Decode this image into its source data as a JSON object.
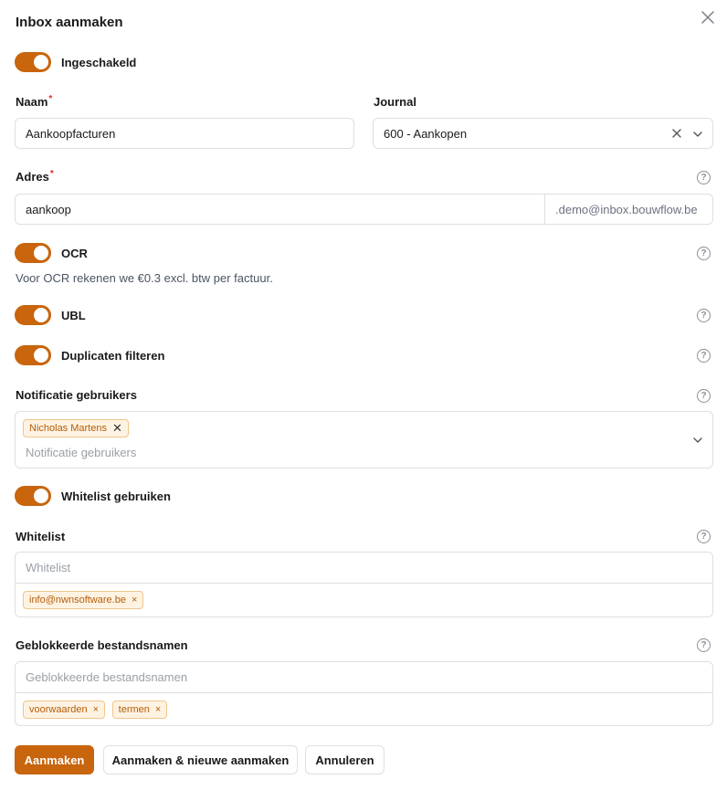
{
  "dialog": {
    "title": "Inbox aanmaken"
  },
  "enabled": {
    "label": "Ingeschakeld",
    "on": true
  },
  "naam": {
    "label": "Naam",
    "required_mark": "*",
    "value": "Aankoopfacturen"
  },
  "journal": {
    "label": "Journal",
    "value": "600 - Aankopen"
  },
  "adres": {
    "label": "Adres",
    "required_mark": "*",
    "value": "aankoop",
    "suffix": ".demo@inbox.bouwflow.be"
  },
  "ocr": {
    "label": "OCR",
    "on": true,
    "description": "Voor OCR rekenen we €0.3 excl. btw per factuur."
  },
  "ubl": {
    "label": "UBL",
    "on": true
  },
  "duplicates": {
    "label": "Duplicaten filteren",
    "on": true
  },
  "notifications": {
    "label": "Notificatie gebruikers",
    "placeholder": "Notificatie gebruikers",
    "tags": [
      "Nicholas Martens"
    ]
  },
  "whitelist_toggle": {
    "label": "Whitelist gebruiken",
    "on": true
  },
  "whitelist": {
    "label": "Whitelist",
    "placeholder": "Whitelist",
    "tags": [
      "info@nwnsoftware.be"
    ]
  },
  "blocked": {
    "label": "Geblokkeerde bestandsnamen",
    "placeholder": "Geblokkeerde bestandsnamen",
    "tags": [
      "voorwaarden",
      "termen"
    ]
  },
  "buttons": {
    "create": "Aanmaken",
    "create_new": "Aanmaken & nieuwe aanmaken",
    "cancel": "Annuleren"
  },
  "icons": {
    "close": "close-icon",
    "clear": "clear-icon",
    "chevron": "chevron-down-icon",
    "help": "help-icon",
    "tag_remove": "remove-tag-icon"
  },
  "colors": {
    "accent": "#c8650d",
    "tag_bg": "#fef3e2",
    "tag_border": "#f0c58a",
    "tag_text": "#b45c0a",
    "required": "#d93025"
  }
}
